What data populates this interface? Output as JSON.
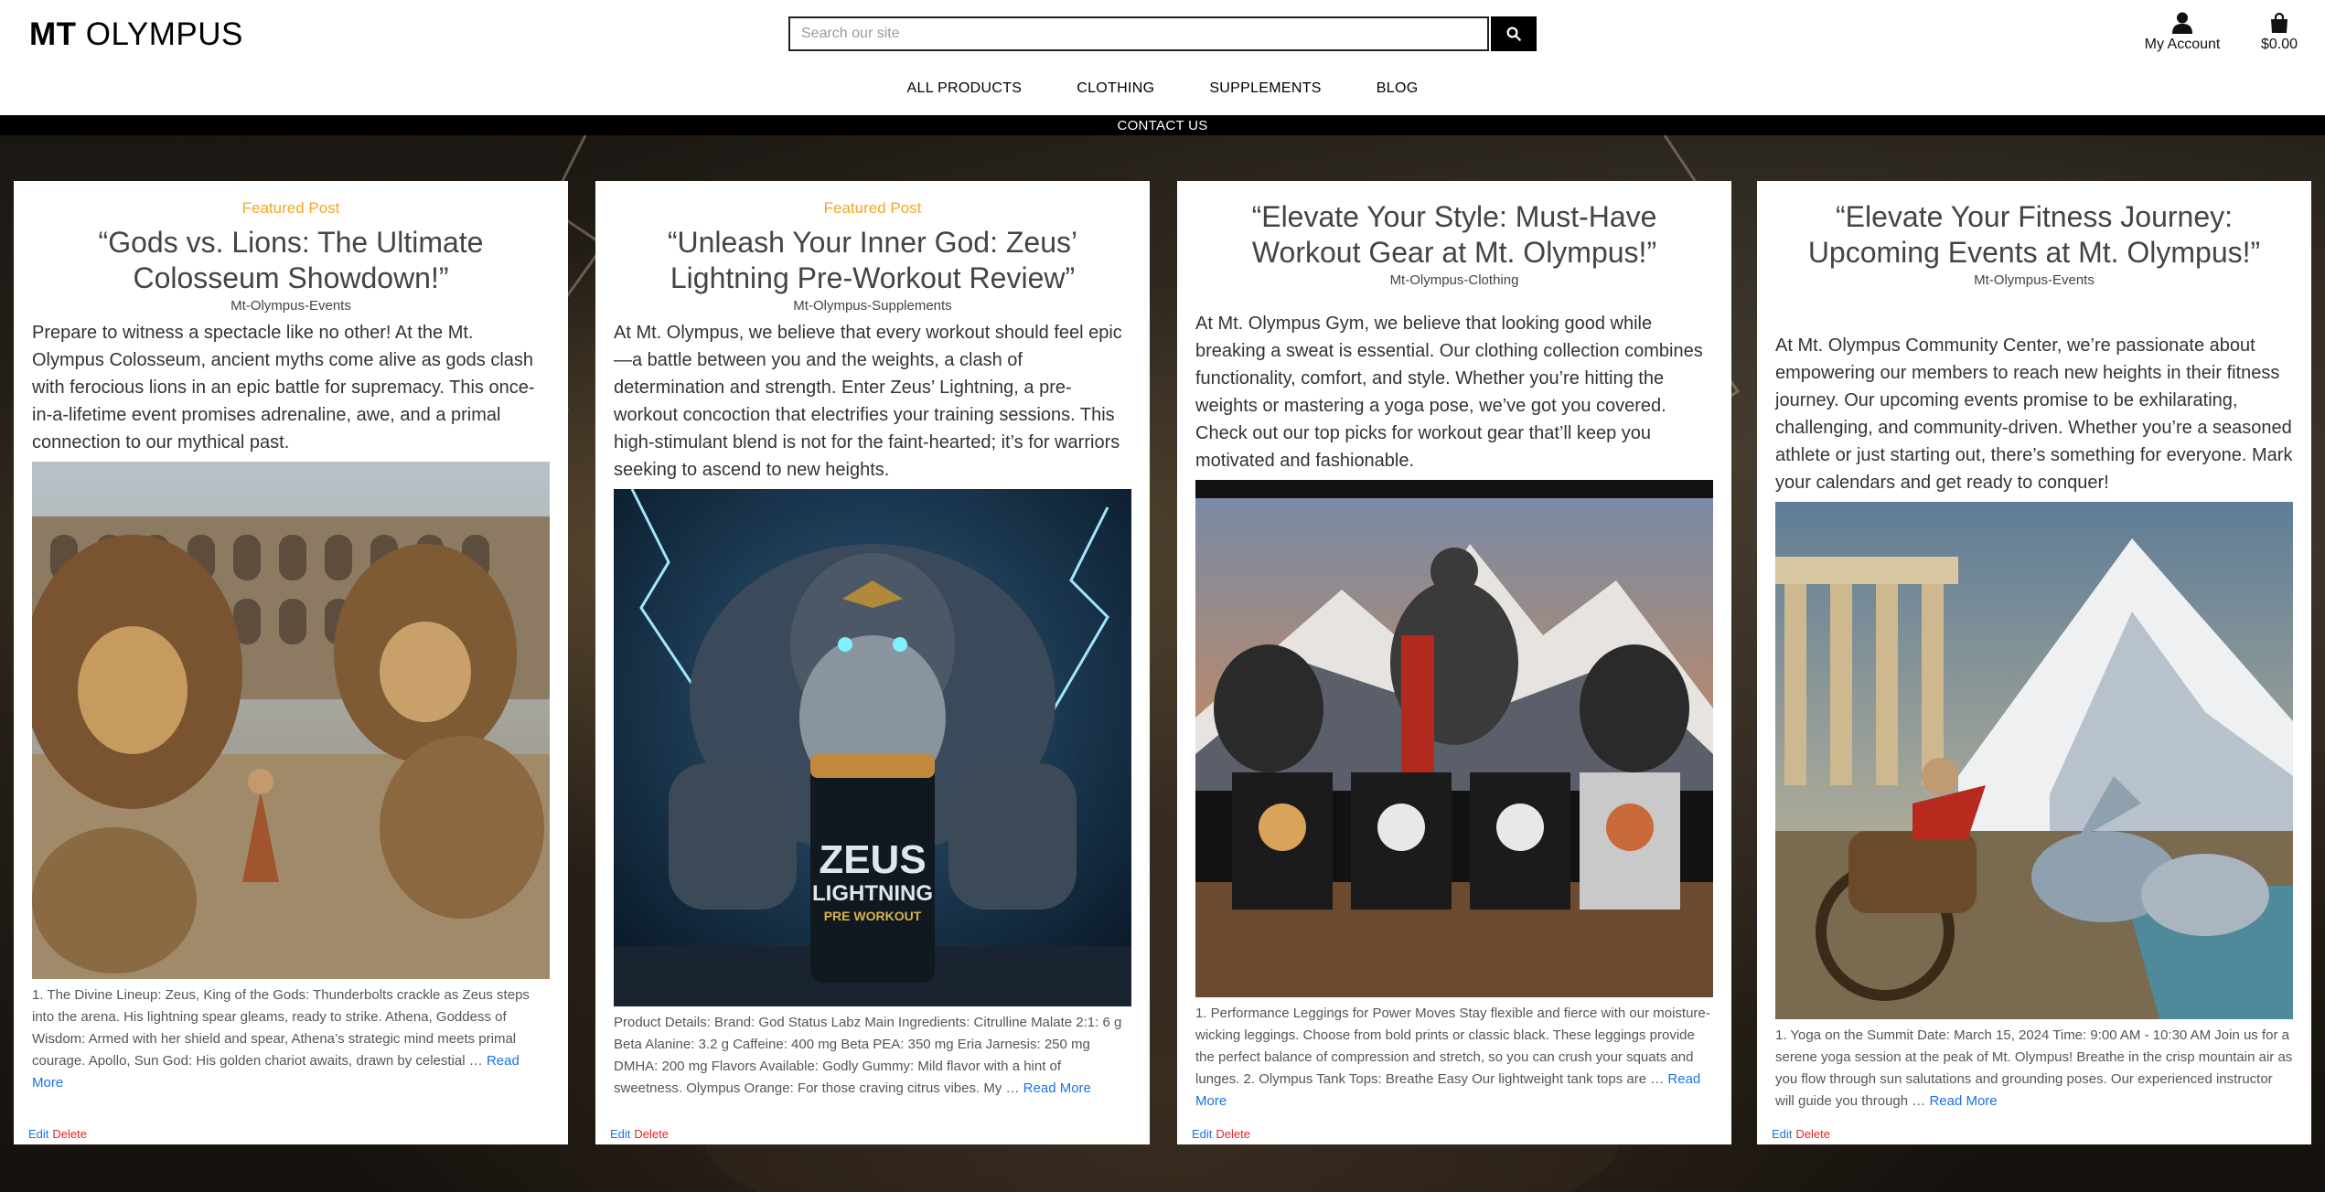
{
  "header": {
    "logo_bold": "MT",
    "logo_light": "OLYMPUS",
    "search_placeholder": "Search our site",
    "account_label": "My Account",
    "bag_total": "$0.00"
  },
  "nav": {
    "items": [
      "ALL PRODUCTS",
      "CLOTHING",
      "SUPPLEMENTS",
      "BLOG"
    ],
    "contact": "CONTACT US"
  },
  "posts": [
    {
      "featured": "Featured Post",
      "title": "“Gods vs. Lions: The Ultimate Colosseum Showdown!”",
      "category": "Mt-Olympus-Events",
      "intro": "Prepare to witness a spectacle like no other! At the Mt. Olympus Colosseum, ancient myths come alive as gods clash with ferocious lions in an epic battle for supremacy. This once-in-a-lifetime event promises adrenaline, awe, and a primal connection to our mythical past.",
      "image_alt": "Gods battling lions in the Colosseum",
      "excerpt": "1. The Divine Lineup: Zeus, King of the Gods: Thunderbolts crackle as Zeus steps into the arena. His lightning spear gleams, ready to strike. Athena, Goddess of Wisdom: Armed with her shield and spear, Athena’s strategic mind meets primal courage. Apollo, Sun God: His golden chariot awaits, drawn by celestial …",
      "read_more": "Read More",
      "edit": "Edit",
      "delete": "Delete"
    },
    {
      "featured": "Featured Post",
      "title": "“Unleash Your Inner God: Zeus’ Lightning Pre-Workout Review”",
      "category": "Mt-Olympus-Supplements",
      "intro": "At Mt. Olympus, we believe that every workout should feel epic—a battle between you and the weights, a clash of determination and strength. Enter Zeus’ Lightning, a pre-workout concoction that electrifies your training sessions. This high-stimulant blend is not for the faint-hearted; it’s for warriors seeking to ascend to new heights.",
      "image_alt": "Zeus holding Zeus Lightning pre-workout tub",
      "product_label_1": "ZEUS",
      "product_label_2": "LIGHTNING",
      "product_label_3": "PRE WORKOUT",
      "excerpt": "Product Details: Brand: God Status Labz Main Ingredients: Citrulline Malate 2:1: 6 g Beta Alanine: 3.2 g Caffeine: 400 mg Beta PEA: 350 mg Eria Jarnesis: 250 mg DMHA: 200 mg Flavors Available: Godly Gummy: Mild flavor with a hint of sweetness. Olympus Orange: For those craving citrus vibes. My …",
      "read_more": "Read More",
      "edit": "Edit",
      "delete": "Delete"
    },
    {
      "featured": "",
      "title": "“Elevate Your Style: Must-Have Workout Gear at Mt. Olympus!”",
      "category": "Mt-Olympus-Clothing",
      "intro": "At Mt. Olympus Gym, we believe that looking good while breaking a sweat is essential. Our clothing collection combines functionality, comfort, and style. Whether you’re hitting the weights or mastering a yoga pose, we’ve got you covered. Check out our top picks for workout gear that’ll keep you motivated and fashionable.",
      "image_alt": "Workout gear store with mountain backdrop",
      "excerpt": "1. Performance Leggings for Power Moves Stay flexible and fierce with our moisture-wicking leggings. Choose from bold prints or classic black. These leggings provide the perfect balance of compression and stretch, so you can crush your squats and lunges. 2. Olympus Tank Tops: Breathe Easy Our lightweight tank tops are …",
      "read_more": "Read More",
      "edit": "Edit",
      "delete": "Delete"
    },
    {
      "featured": "",
      "title": "“Elevate Your Fitness Journey: Upcoming Events at Mt. Olympus!”",
      "category": "Mt-Olympus-Events",
      "intro": "At Mt. Olympus Community Center, we’re passionate about empowering our members to reach new heights in their fitness journey. Our upcoming events promise to be exhilarating, challenging, and community-driven. Whether you’re a seasoned athlete or just starting out, there’s something for everyone. Mark your calendars and get ready to conquer!",
      "image_alt": "Chariot racing before a mountain temple",
      "excerpt": "1. Yoga on the Summit Date: March 15, 2024 Time: 9:00 AM - 10:30 AM Join us for a serene yoga session at the peak of Mt. Olympus! Breathe in the crisp mountain air as you flow through sun salutations and grounding poses. Our experienced instructor will guide you through …",
      "read_more": "Read More",
      "edit": "Edit",
      "delete": "Delete"
    }
  ],
  "colors": {
    "featured": "#f5a623",
    "link": "#1a73e8",
    "delete": "#e02424"
  }
}
